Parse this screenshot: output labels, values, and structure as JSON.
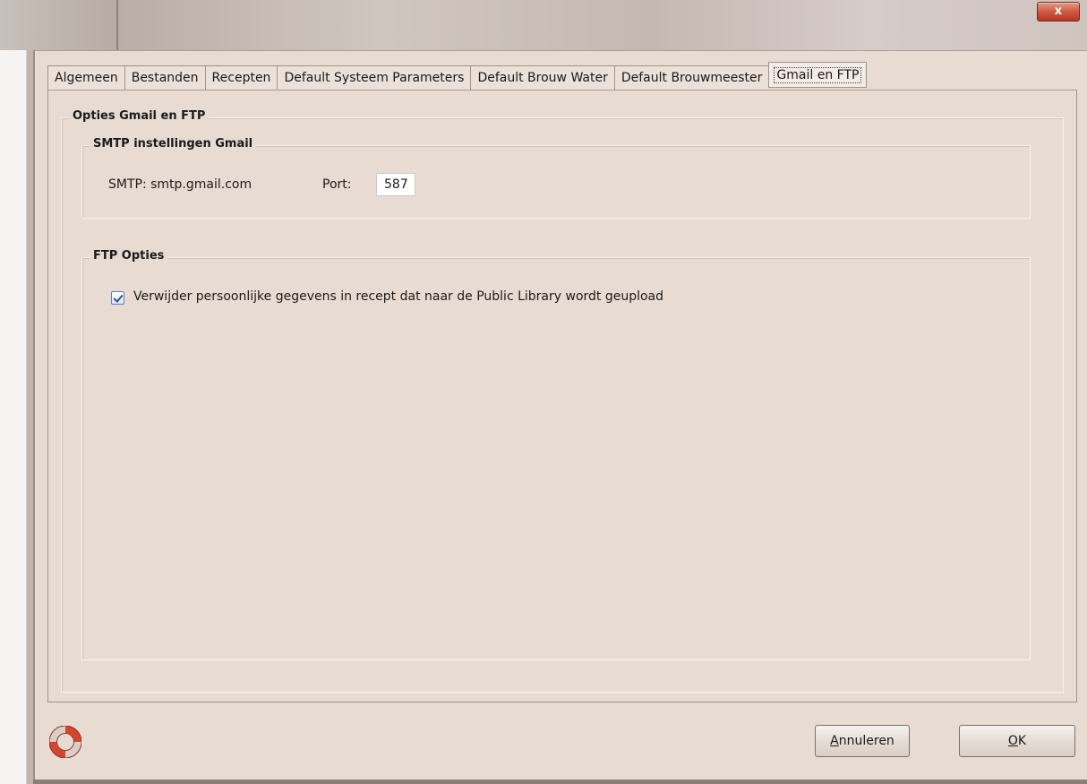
{
  "window": {
    "close_label": "x"
  },
  "tabs": [
    {
      "label": "Algemeen"
    },
    {
      "label": "Bestanden"
    },
    {
      "label": "Recepten"
    },
    {
      "label": "Default Systeem Parameters"
    },
    {
      "label": "Default Brouw Water"
    },
    {
      "label": "Default Brouwmeester"
    },
    {
      "label": "Gmail en FTP",
      "active": true
    }
  ],
  "options": {
    "legend": "Opties Gmail en FTP",
    "smtp": {
      "legend": "SMTP instellingen Gmail",
      "server_label": "SMTP: smtp.gmail.com",
      "port_label": "Port:",
      "port_value": "587"
    },
    "ftp": {
      "legend": "FTP Opties",
      "checkbox_checked": true,
      "checkbox_label": "Verwijder persoonlijke gegevens in recept dat naar de Public Library wordt geupload"
    }
  },
  "footer": {
    "help_icon": "lifebuoy-icon",
    "cancel": {
      "mnemonic": "A",
      "rest": "nnuleren"
    },
    "ok": {
      "mnemonic": "O",
      "rest": "K"
    }
  }
}
